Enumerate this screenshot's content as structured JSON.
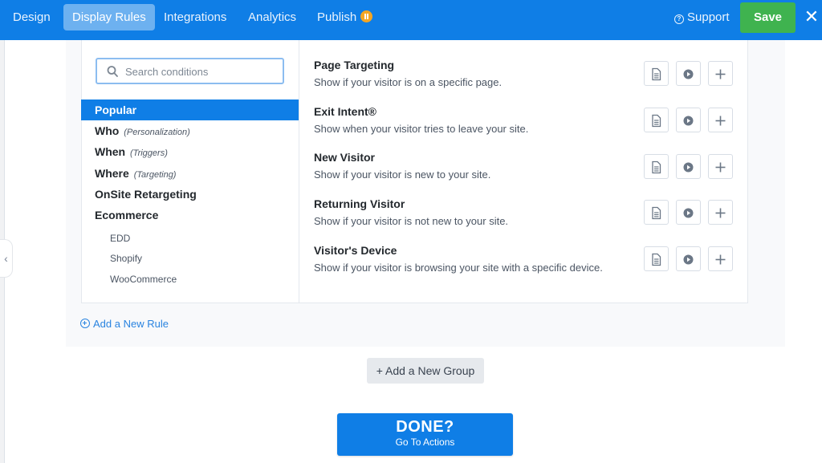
{
  "topbar": {
    "tabs": [
      {
        "label": "Design",
        "active": false
      },
      {
        "label": "Display Rules",
        "active": true
      },
      {
        "label": "Integrations",
        "active": false
      },
      {
        "label": "Analytics",
        "active": false
      },
      {
        "label": "Publish",
        "active": false,
        "status_icon": "pause-icon",
        "status_color": "#f5a623"
      }
    ],
    "support_label": "Support",
    "save_label": "Save",
    "close_glyph": "✕"
  },
  "search": {
    "placeholder": "Search conditions",
    "value": ""
  },
  "categories": [
    {
      "label": "Popular",
      "hint": "",
      "active": true
    },
    {
      "label": "Who",
      "hint": "(Personalization)",
      "active": false
    },
    {
      "label": "When",
      "hint": "(Triggers)",
      "active": false
    },
    {
      "label": "Where",
      "hint": "(Targeting)",
      "active": false
    },
    {
      "label": "OnSite Retargeting",
      "hint": "",
      "active": false
    },
    {
      "label": "Ecommerce",
      "hint": "",
      "active": false
    }
  ],
  "subcategories": [
    "EDD",
    "Shopify",
    "WooCommerce"
  ],
  "conditions": [
    {
      "title": "Page Targeting",
      "description": "Show if your visitor is on a specific page."
    },
    {
      "title": "Exit Intent®",
      "description": "Show when your visitor tries to leave your site."
    },
    {
      "title": "New Visitor",
      "description": "Show if your visitor is new to your site."
    },
    {
      "title": "Returning Visitor",
      "description": "Show if your visitor is not new to your site."
    },
    {
      "title": "Visitor's Device",
      "description": "Show if your visitor is browsing your site with a specific device."
    }
  ],
  "condition_actions": [
    "document-icon",
    "play-icon",
    "plus-icon"
  ],
  "add_rule_label": "Add a New Rule",
  "add_group_label": "+ Add a New Group",
  "done": {
    "title": "DONE?",
    "subtitle": "Go To Actions"
  },
  "colors": {
    "primary": "#0f7ee6",
    "save": "#3fb34f",
    "publish_status": "#f5a623"
  }
}
